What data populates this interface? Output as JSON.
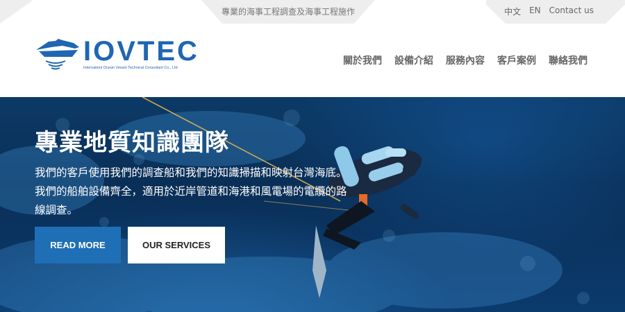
{
  "topbar": {
    "tagline": "專業的海事工程調查及海事工程施作",
    "lang_zh": "中文",
    "lang_en": "EN",
    "contact": "Contact us"
  },
  "brand": {
    "name": "IOVTEC",
    "subtitle": "Internationl Ocean Vessel Technical Consultant Co., Ltd",
    "color": "#1f66b3"
  },
  "nav": {
    "items": [
      "關於我們",
      "設備介紹",
      "服務內容",
      "客戶案例",
      "聯絡我們"
    ]
  },
  "hero": {
    "title": "專業地質知識團隊",
    "description": "我們的客戶使用我們的調查船和我們的知識掃描和映射台灣海底。我們的船舶設備齊全，適用於近岸管道和海港和風電場的電纜的路線調查。",
    "primary_button": "READ MORE",
    "secondary_button": "OUR SERVICES",
    "accent_color": "#1f6fb6"
  }
}
